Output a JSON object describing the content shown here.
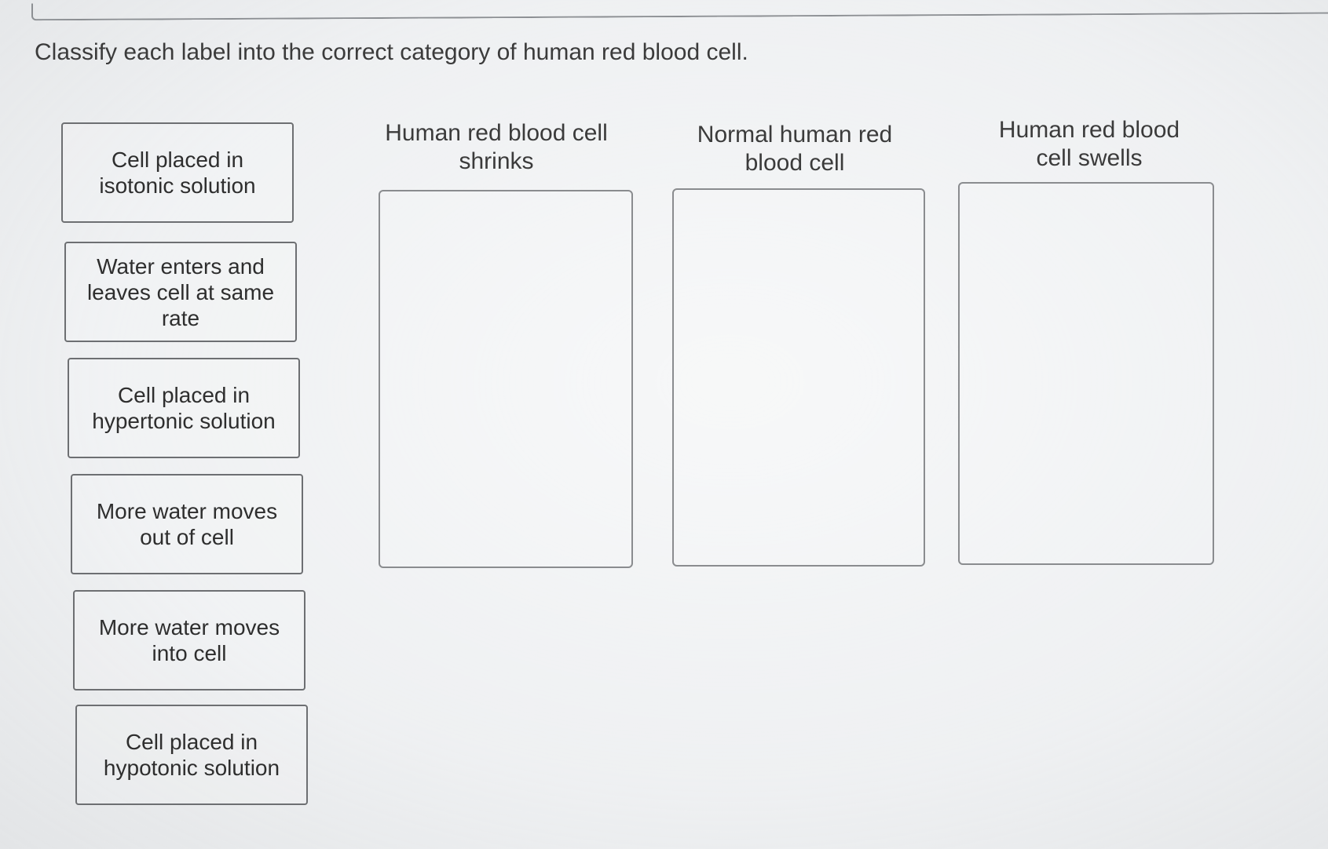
{
  "instruction": "Classify each label into the correct category of human red blood cell.",
  "labels": [
    "Cell placed in\nisotonic solution",
    "Water enters and\nleaves cell at same\nrate",
    "Cell placed in\nhypertonic solution",
    "More water moves\nout of cell",
    "More water moves\ninto cell",
    "Cell placed in\nhypotonic solution"
  ],
  "categories": [
    "Human red blood cell\nshrinks",
    "Normal human red\nblood cell",
    "Human red blood\ncell swells"
  ]
}
